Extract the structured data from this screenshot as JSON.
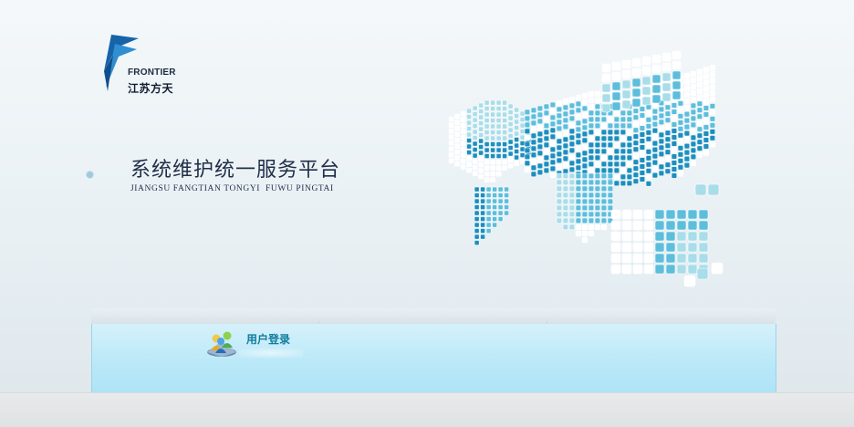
{
  "brand": {
    "logo_en": "FRONTIER",
    "logo_cn": "江苏方天",
    "logo_colors": {
      "dark": "#1663a8",
      "light": "#3aa6e0"
    }
  },
  "hero": {
    "title_cn": "系统维护统一服务平台",
    "title_en": "JIANGSU FANGTIAN TONGYI  FUWU PINGTAI"
  },
  "login": {
    "label": "用户登录",
    "icon": "users-icon"
  },
  "colors": {
    "accent": "#117c9e",
    "panel": "#b9e8f8",
    "map_dark": "#1c8fbf",
    "map_mid": "#5dbedc",
    "map_light": "#a9dde9"
  }
}
